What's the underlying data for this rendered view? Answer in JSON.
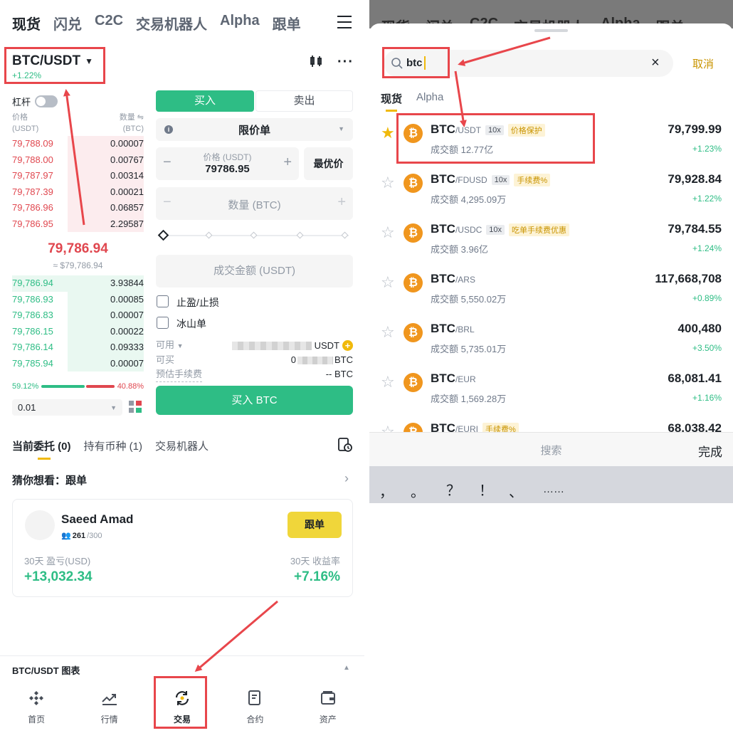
{
  "left": {
    "top_tabs": [
      "现货",
      "闪兑",
      "C2C",
      "交易机器人",
      "Alpha",
      "跟单"
    ],
    "pair": {
      "symbol": "BTC/USDT",
      "change": "+1.22%"
    },
    "leverage_label": "杠杆",
    "orderbook": {
      "price_header": "价格\n(USDT)",
      "qty_header": "数量 ⇋\n(BTC)",
      "asks": [
        {
          "price": "79,788.09",
          "qty": "0.00007",
          "depth": 0.58
        },
        {
          "price": "79,788.00",
          "qty": "0.00767",
          "depth": 0.58
        },
        {
          "price": "79,787.97",
          "qty": "0.00314",
          "depth": 0.58
        },
        {
          "price": "79,787.39",
          "qty": "0.00021",
          "depth": 0.58
        },
        {
          "price": "79,786.96",
          "qty": "0.06857",
          "depth": 0.58
        },
        {
          "price": "79,786.95",
          "qty": "2.29587",
          "depth": 0.58
        }
      ],
      "last_price": "79,786.94",
      "last_price_usd": "≈ $79,786.94",
      "bids": [
        {
          "price": "79,786.94",
          "qty": "3.93844",
          "depth": 1.0
        },
        {
          "price": "79,786.93",
          "qty": "0.00085",
          "depth": 0.58
        },
        {
          "price": "79,786.83",
          "qty": "0.00007",
          "depth": 0.58
        },
        {
          "price": "79,786.15",
          "qty": "0.00022",
          "depth": 0.58
        },
        {
          "price": "79,786.14",
          "qty": "0.09333",
          "depth": 0.58
        },
        {
          "price": "79,785.94",
          "qty": "0.00007",
          "depth": 0.58
        }
      ],
      "buy_ratio": "59.12%",
      "sell_ratio": "40.88%",
      "buy_ratio_value": 0.5912,
      "precision": "0.01"
    },
    "order_form": {
      "buy_tab": "买入",
      "sell_tab": "卖出",
      "order_type": "限价单",
      "price_label": "价格 (USDT)",
      "price_value": "79786.95",
      "best_price": "最优价",
      "qty_placeholder": "数量 (BTC)",
      "amount_placeholder": "成交金额 (USDT)",
      "tp_sl": "止盈/止损",
      "iceberg": "冰山单",
      "available_label": "可用",
      "available_unit": "USDT",
      "can_buy_label": "可买",
      "can_buy_unit": "BTC",
      "can_buy_prefix": "0",
      "fee_label": "预估手续费",
      "fee_value": "-- BTC",
      "submit": "买入 BTC"
    },
    "orders_tabs": [
      "当前委托 (0)",
      "持有币种 (1)",
      "交易机器人"
    ],
    "suggest_title": "猜你想看：跟单",
    "trader": {
      "name": "Saeed Amad",
      "followers": "261",
      "followers_max": "/300",
      "follow_button": "跟单",
      "pnl_label": "30天 盈亏(USD)",
      "pnl_value": "+13,032.34",
      "roi_label": "30天 收益率",
      "roi_value": "+7.16%"
    },
    "chart_bar": "BTC/USDT 图表",
    "bottom_nav": [
      "首页",
      "行情",
      "交易",
      "合约",
      "资产"
    ]
  },
  "right": {
    "search_value": "btc",
    "cancel": "取消",
    "tabs": [
      "现货",
      "Alpha"
    ],
    "results": [
      {
        "base": "BTC",
        "quote": "/USDT",
        "lev": "10x",
        "tag": "价格保护",
        "volume": "成交额 12.77亿",
        "price": "79,799.99",
        "change": "+1.23%",
        "starred": true
      },
      {
        "base": "BTC",
        "quote": "/FDUSD",
        "lev": "10x",
        "tag": "手续费%",
        "volume": "成交额 4,295.09万",
        "price": "79,928.84",
        "change": "+1.22%",
        "starred": false
      },
      {
        "base": "BTC",
        "quote": "/USDC",
        "lev": "10x",
        "tag": "吃单手续费优惠",
        "volume": "成交额 3.96亿",
        "price": "79,784.55",
        "change": "+1.24%",
        "starred": false
      },
      {
        "base": "BTC",
        "quote": "/ARS",
        "lev": "",
        "tag": "",
        "volume": "成交额 5,550.02万",
        "price": "117,668,708",
        "change": "+0.89%",
        "starred": false
      },
      {
        "base": "BTC",
        "quote": "/BRL",
        "lev": "",
        "tag": "",
        "volume": "成交额 5,735.01万",
        "price": "400,480",
        "change": "+3.50%",
        "starred": false
      },
      {
        "base": "BTC",
        "quote": "/EUR",
        "lev": "",
        "tag": "",
        "volume": "成交额 1,569.28万",
        "price": "68,081.41",
        "change": "+1.16%",
        "starred": false
      },
      {
        "base": "BTC",
        "quote": "/EURI",
        "lev": "",
        "tag": "手续费%",
        "volume": "",
        "price": "68,038.42",
        "change": "",
        "starred": false
      }
    ],
    "keyboard": {
      "search_key": "搜索",
      "done_key": "完成",
      "symbols": [
        "，",
        "。",
        "？",
        "！",
        "、",
        "……"
      ]
    }
  },
  "colors": {
    "green": "#2ebd85",
    "red": "#e0474f",
    "yellow": "#f0d63a",
    "annotation": "#e8464b"
  }
}
